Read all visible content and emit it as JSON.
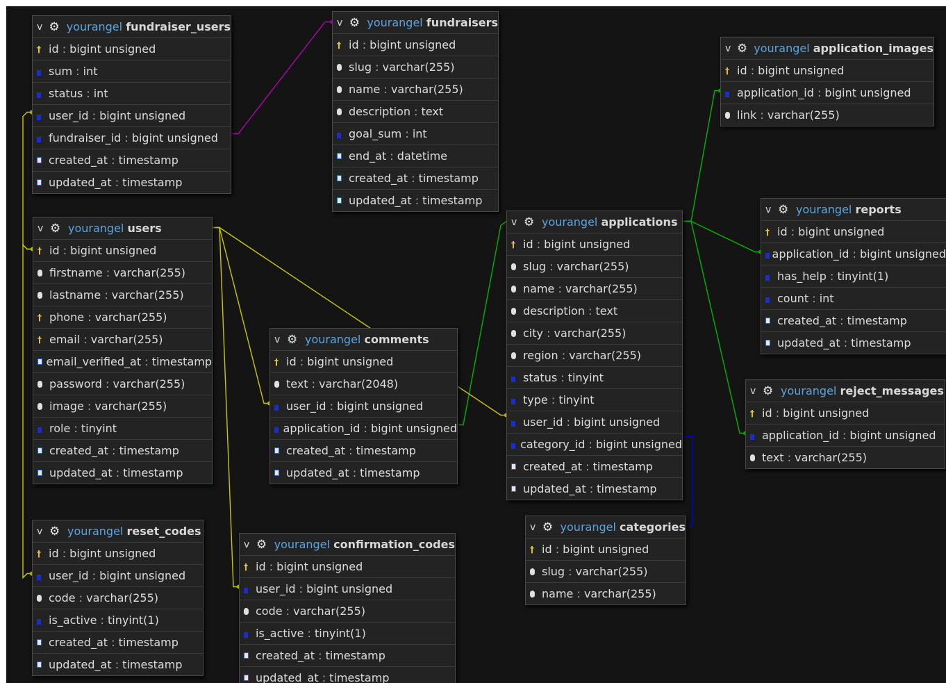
{
  "tables": [
    {
      "id": "fundraiser_users",
      "prefix": "yourangel",
      "name": "fundraiser_users",
      "fields": [
        {
          "icon": "key",
          "name": "id",
          "type": "bigint unsigned"
        },
        {
          "icon": "num",
          "name": "sum",
          "type": "int"
        },
        {
          "icon": "num",
          "name": "status",
          "type": "int"
        },
        {
          "icon": "num",
          "name": "user_id",
          "type": "bigint unsigned"
        },
        {
          "icon": "num",
          "name": "fundraiser_id",
          "type": "bigint unsigned"
        },
        {
          "icon": "time",
          "name": "created_at",
          "type": "timestamp"
        },
        {
          "icon": "time",
          "name": "updated_at",
          "type": "timestamp"
        }
      ]
    },
    {
      "id": "fundraisers",
      "prefix": "yourangel",
      "name": "fundraisers",
      "fields": [
        {
          "icon": "key",
          "name": "id",
          "type": "bigint unsigned"
        },
        {
          "icon": "str",
          "name": "slug",
          "type": "varchar(255)"
        },
        {
          "icon": "str",
          "name": "name",
          "type": "varchar(255)"
        },
        {
          "icon": "str",
          "name": "description",
          "type": "text"
        },
        {
          "icon": "num",
          "name": "goal_sum",
          "type": "int"
        },
        {
          "icon": "time",
          "name": "end_at",
          "type": "datetime"
        },
        {
          "icon": "time",
          "name": "created_at",
          "type": "timestamp"
        },
        {
          "icon": "time",
          "name": "updated_at",
          "type": "timestamp"
        }
      ]
    },
    {
      "id": "application_images",
      "prefix": "yourangel",
      "name": "application_images",
      "fields": [
        {
          "icon": "key",
          "name": "id",
          "type": "bigint unsigned"
        },
        {
          "icon": "num",
          "name": "application_id",
          "type": "bigint unsigned"
        },
        {
          "icon": "str",
          "name": "link",
          "type": "varchar(255)"
        }
      ]
    },
    {
      "id": "users",
      "prefix": "yourangel",
      "name": "users",
      "fields": [
        {
          "icon": "key",
          "name": "id",
          "type": "bigint unsigned"
        },
        {
          "icon": "str",
          "name": "firstname",
          "type": "varchar(255)"
        },
        {
          "icon": "str",
          "name": "lastname",
          "type": "varchar(255)"
        },
        {
          "icon": "key",
          "name": "phone",
          "type": "varchar(255)"
        },
        {
          "icon": "key",
          "name": "email",
          "type": "varchar(255)"
        },
        {
          "icon": "time",
          "name": "email_verified_at",
          "type": "timestamp"
        },
        {
          "icon": "str",
          "name": "password",
          "type": "varchar(255)"
        },
        {
          "icon": "str",
          "name": "image",
          "type": "varchar(255)"
        },
        {
          "icon": "num",
          "name": "role",
          "type": "tinyint"
        },
        {
          "icon": "time",
          "name": "created_at",
          "type": "timestamp"
        },
        {
          "icon": "time",
          "name": "updated_at",
          "type": "timestamp"
        }
      ]
    },
    {
      "id": "applications",
      "prefix": "yourangel",
      "name": "applications",
      "fields": [
        {
          "icon": "key",
          "name": "id",
          "type": "bigint unsigned"
        },
        {
          "icon": "str",
          "name": "slug",
          "type": "varchar(255)"
        },
        {
          "icon": "str",
          "name": "name",
          "type": "varchar(255)"
        },
        {
          "icon": "str",
          "name": "description",
          "type": "text"
        },
        {
          "icon": "str",
          "name": "city",
          "type": "varchar(255)"
        },
        {
          "icon": "str",
          "name": "region",
          "type": "varchar(255)"
        },
        {
          "icon": "num",
          "name": "status",
          "type": "tinyint"
        },
        {
          "icon": "num",
          "name": "type",
          "type": "tinyint"
        },
        {
          "icon": "num",
          "name": "user_id",
          "type": "bigint unsigned"
        },
        {
          "icon": "num",
          "name": "category_id",
          "type": "bigint unsigned"
        },
        {
          "icon": "time",
          "name": "created_at",
          "type": "timestamp"
        },
        {
          "icon": "time",
          "name": "updated_at",
          "type": "timestamp"
        }
      ]
    },
    {
      "id": "reports",
      "prefix": "yourangel",
      "name": "reports",
      "fields": [
        {
          "icon": "key",
          "name": "id",
          "type": "bigint unsigned"
        },
        {
          "icon": "num",
          "name": "application_id",
          "type": "bigint unsigned"
        },
        {
          "icon": "num",
          "name": "has_help",
          "type": "tinyint(1)"
        },
        {
          "icon": "num",
          "name": "count",
          "type": "int"
        },
        {
          "icon": "time",
          "name": "created_at",
          "type": "timestamp"
        },
        {
          "icon": "time",
          "name": "updated_at",
          "type": "timestamp"
        }
      ]
    },
    {
      "id": "comments",
      "prefix": "yourangel",
      "name": "comments",
      "fields": [
        {
          "icon": "key",
          "name": "id",
          "type": "bigint unsigned"
        },
        {
          "icon": "str",
          "name": "text",
          "type": "varchar(2048)"
        },
        {
          "icon": "num",
          "name": "user_id",
          "type": "bigint unsigned"
        },
        {
          "icon": "num",
          "name": "application_id",
          "type": "bigint unsigned"
        },
        {
          "icon": "time",
          "name": "created_at",
          "type": "timestamp"
        },
        {
          "icon": "time",
          "name": "updated_at",
          "type": "timestamp"
        }
      ]
    },
    {
      "id": "reject_messages",
      "prefix": "yourangel",
      "name": "reject_messages",
      "fields": [
        {
          "icon": "key",
          "name": "id",
          "type": "bigint unsigned"
        },
        {
          "icon": "num",
          "name": "application_id",
          "type": "bigint unsigned"
        },
        {
          "icon": "str",
          "name": "text",
          "type": "varchar(255)"
        }
      ]
    },
    {
      "id": "categories",
      "prefix": "yourangel",
      "name": "categories",
      "fields": [
        {
          "icon": "key",
          "name": "id",
          "type": "bigint unsigned"
        },
        {
          "icon": "str",
          "name": "slug",
          "type": "varchar(255)"
        },
        {
          "icon": "str",
          "name": "name",
          "type": "varchar(255)"
        }
      ]
    },
    {
      "id": "reset_codes",
      "prefix": "yourangel",
      "name": "reset_codes",
      "fields": [
        {
          "icon": "key",
          "name": "id",
          "type": "bigint unsigned"
        },
        {
          "icon": "num",
          "name": "user_id",
          "type": "bigint unsigned"
        },
        {
          "icon": "str",
          "name": "code",
          "type": "varchar(255)"
        },
        {
          "icon": "num",
          "name": "is_active",
          "type": "tinyint(1)"
        },
        {
          "icon": "time",
          "name": "created_at",
          "type": "timestamp"
        },
        {
          "icon": "time",
          "name": "updated_at",
          "type": "timestamp"
        }
      ]
    },
    {
      "id": "confirmation_codes",
      "prefix": "yourangel",
      "name": "confirmation_codes",
      "fields": [
        {
          "icon": "key",
          "name": "id",
          "type": "bigint unsigned"
        },
        {
          "icon": "num",
          "name": "user_id",
          "type": "bigint unsigned"
        },
        {
          "icon": "str",
          "name": "code",
          "type": "varchar(255)"
        },
        {
          "icon": "num",
          "name": "is_active",
          "type": "tinyint(1)"
        },
        {
          "icon": "time",
          "name": "created_at",
          "type": "timestamp"
        },
        {
          "icon": "time",
          "name": "updated_at",
          "type": "timestamp"
        }
      ]
    }
  ],
  "relations": [
    {
      "from": "fundraiser_users",
      "field": "user_id",
      "to": "users",
      "color": "#c8c800"
    },
    {
      "from": "fundraiser_users",
      "field": "fundraiser_id",
      "to": "fundraisers",
      "color": "#b400b4"
    },
    {
      "from": "comments",
      "field": "user_id",
      "to": "users",
      "color": "#c8c800"
    },
    {
      "from": "comments",
      "field": "application_id",
      "to": "applications",
      "color": "#00b400"
    },
    {
      "from": "applications",
      "field": "user_id",
      "to": "users",
      "color": "#c8c800"
    },
    {
      "from": "applications",
      "field": "category_id",
      "to": "categories",
      "color": "#0000d2"
    },
    {
      "from": "application_images",
      "field": "application_id",
      "to": "applications",
      "color": "#00b400"
    },
    {
      "from": "reports",
      "field": "application_id",
      "to": "applications",
      "color": "#00b400"
    },
    {
      "from": "reject_messages",
      "field": "application_id",
      "to": "applications",
      "color": "#00b400"
    },
    {
      "from": "reset_codes",
      "field": "user_id",
      "to": "users",
      "color": "#c8c800"
    },
    {
      "from": "confirmation_codes",
      "field": "user_id",
      "to": "users",
      "color": "#c8c800"
    }
  ],
  "ui": {
    "toggle_glyph": "v",
    "gear_glyph": "⚙",
    "field_separator": " : "
  },
  "colors": {
    "background": "#141414",
    "table_bg": "#232323",
    "prefix": "#5aa6e0",
    "key_icon": "#e8c33a",
    "num_icon": "#1a2fc8"
  }
}
